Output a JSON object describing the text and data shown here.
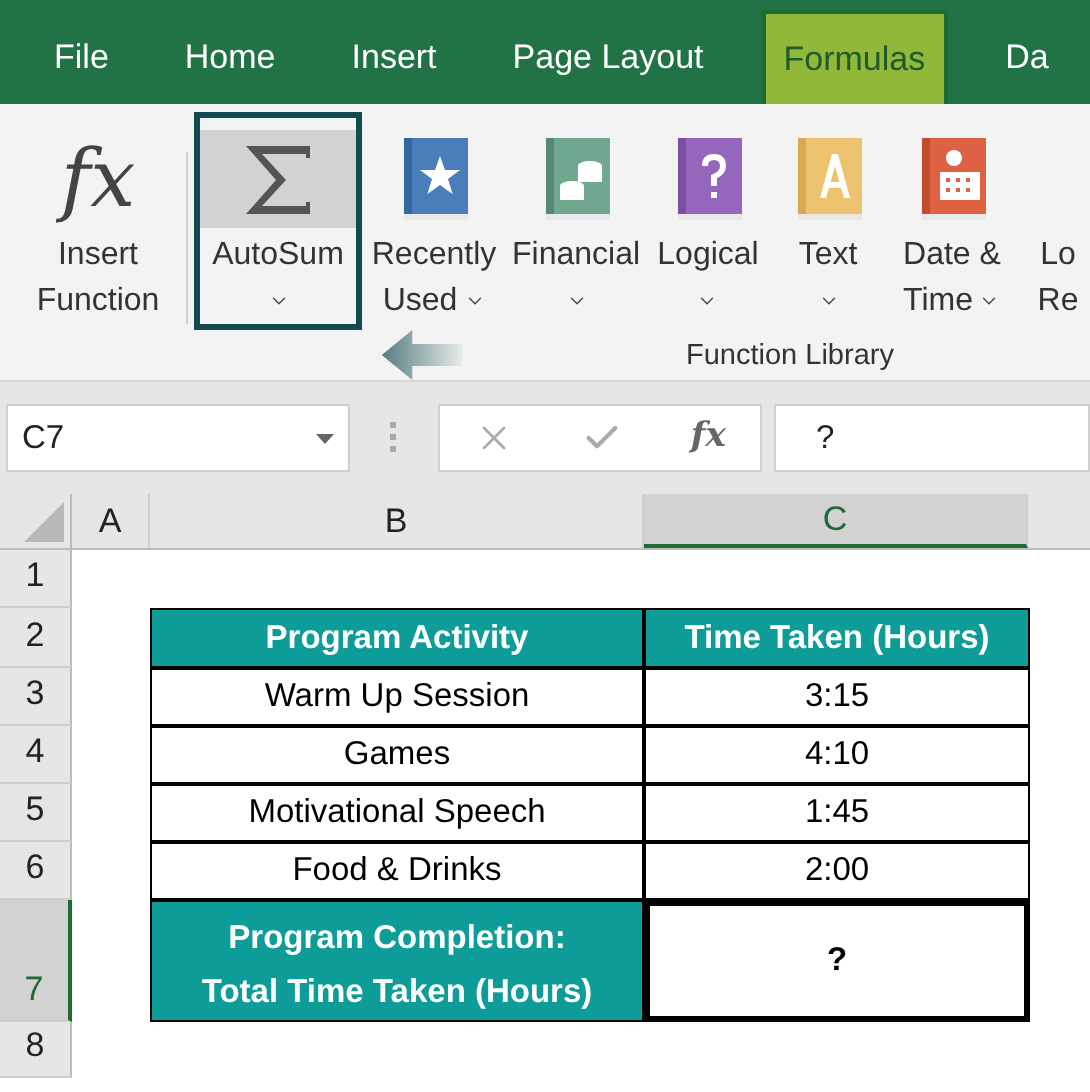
{
  "tabs": [
    {
      "label": "File",
      "selected": false
    },
    {
      "label": "Home",
      "selected": false
    },
    {
      "label": "Insert",
      "selected": false
    },
    {
      "label": "Page Layout",
      "selected": false
    },
    {
      "label": "Formulas",
      "selected": true
    },
    {
      "label": "Da",
      "selected": false
    }
  ],
  "ribbon": {
    "items": [
      {
        "kind": "fx",
        "glyph": "fx",
        "lines": [
          "Insert",
          "Function"
        ],
        "dropdown": false,
        "selected": false
      },
      {
        "kind": "sigma",
        "lines": [
          "AutoSum"
        ],
        "dropdown": true,
        "caret_inline": false,
        "selected": true
      },
      {
        "kind": "star",
        "lines": [
          "Recently",
          "Used"
        ],
        "dropdown": true,
        "caret_inline": true,
        "selected": false
      },
      {
        "kind": "coins",
        "lines": [
          "Financial"
        ],
        "dropdown": true,
        "caret_inline": false,
        "selected": false
      },
      {
        "kind": "question",
        "lines": [
          "Logical"
        ],
        "dropdown": true,
        "caret_inline": false,
        "selected": false
      },
      {
        "kind": "letter",
        "lines": [
          "Text"
        ],
        "dropdown": true,
        "caret_inline": false,
        "selected": false
      },
      {
        "kind": "calendar",
        "lines": [
          "Date &",
          "Time"
        ],
        "dropdown": true,
        "caret_inline": true,
        "selected": false
      },
      {
        "kind": "blank",
        "lines": [
          "Lo",
          "Re"
        ],
        "dropdown": false,
        "selected": false
      }
    ],
    "group_label": "Function Library"
  },
  "formula_bar": {
    "name_box": "C7",
    "function_glyph": "fx",
    "formula": "?"
  },
  "column_headers": [
    {
      "label": "A",
      "selected": false
    },
    {
      "label": "B",
      "selected": false
    },
    {
      "label": "C",
      "selected": true
    }
  ],
  "row_headers": [
    {
      "label": "1",
      "selected": false
    },
    {
      "label": "2",
      "selected": false
    },
    {
      "label": "3",
      "selected": false
    },
    {
      "label": "4",
      "selected": false
    },
    {
      "label": "5",
      "selected": false
    },
    {
      "label": "6",
      "selected": false
    },
    {
      "label": "7",
      "selected": true
    },
    {
      "label": "8",
      "selected": false
    }
  ],
  "table": {
    "columns": [
      "Program Activity",
      "Time Taken (Hours)"
    ],
    "rows": [
      [
        "Warm Up Session",
        "3:15"
      ],
      [
        "Games",
        "4:10"
      ],
      [
        "Motivational Speech",
        "1:45"
      ],
      [
        "Food & Drinks",
        "2:00"
      ]
    ],
    "total": {
      "lines": [
        "Program Completion:",
        "Total Time Taken (Hours)"
      ],
      "value": "?"
    }
  }
}
